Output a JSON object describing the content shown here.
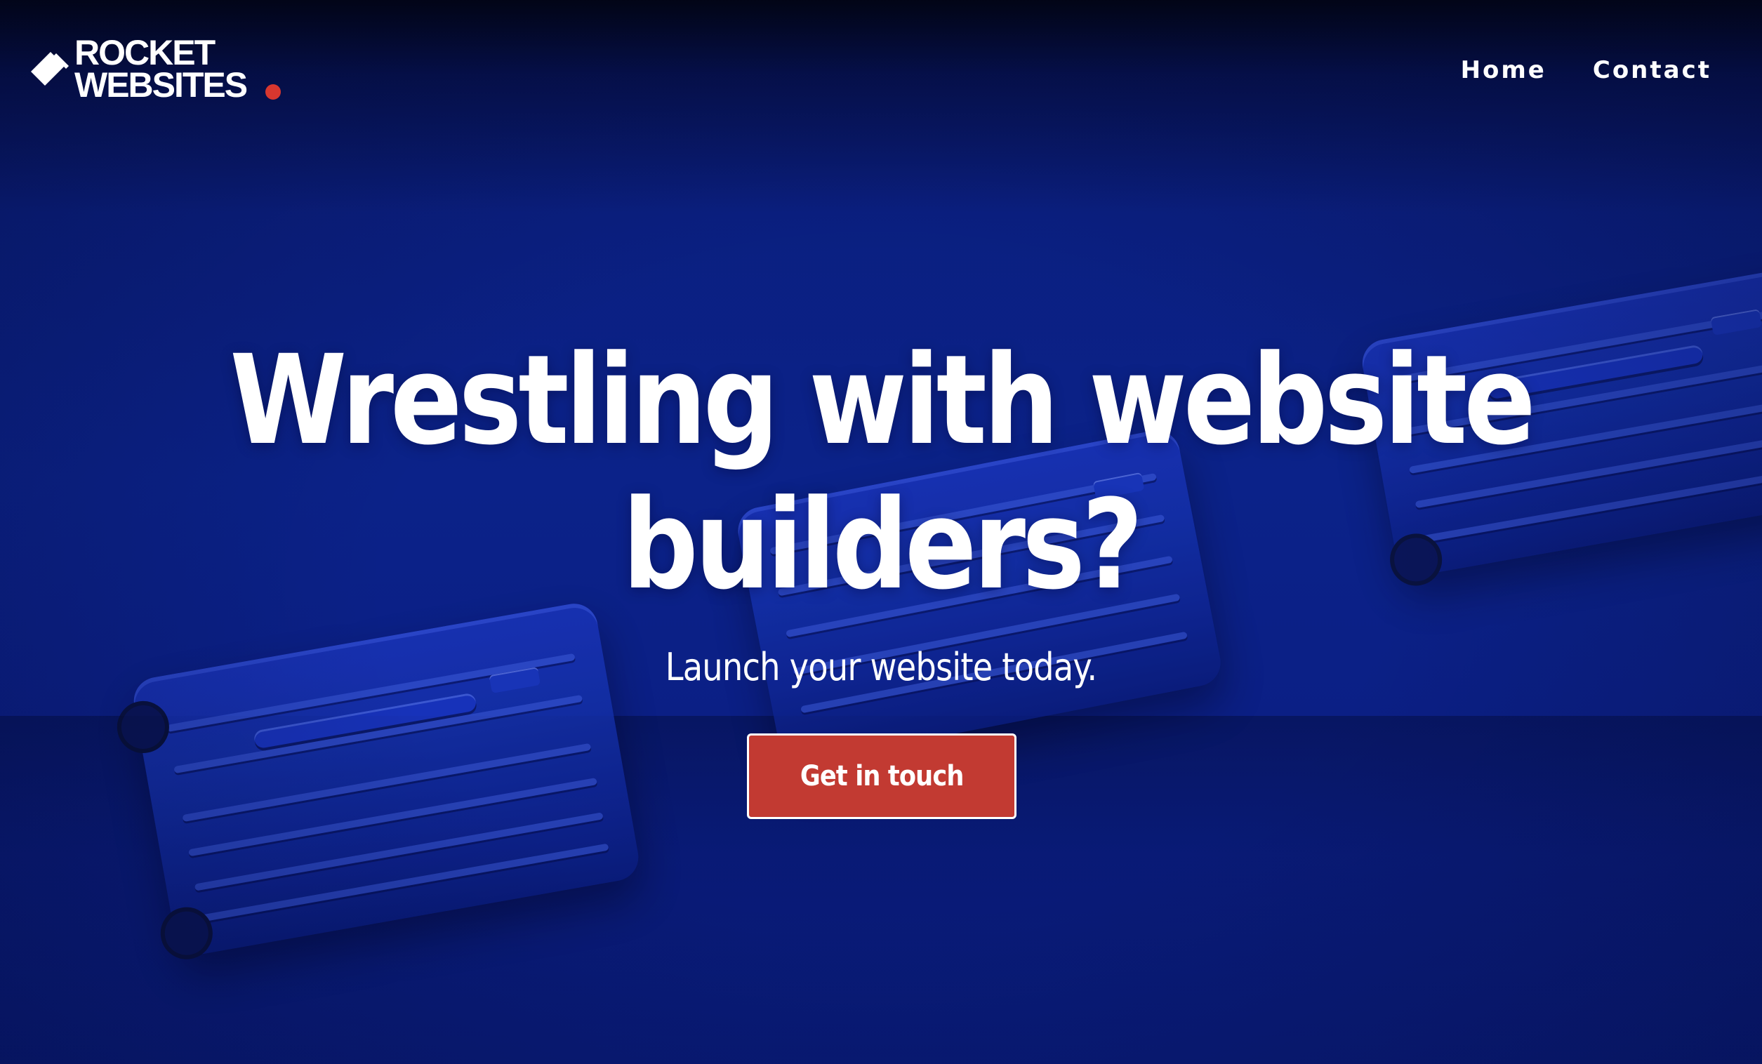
{
  "brand": {
    "line1": "ROCKET",
    "line2": "WEBSITES",
    "accent_color": "#d8372f"
  },
  "nav": {
    "items": [
      {
        "label": "Home"
      },
      {
        "label": "Contact"
      }
    ]
  },
  "hero": {
    "headline_line1": "Wrestling with website",
    "headline_line2": "builders?",
    "subheadline": "Launch your website today.",
    "cta_label": "Get in touch",
    "cta_color": "#c23a32",
    "background_color": "#0b2289"
  }
}
